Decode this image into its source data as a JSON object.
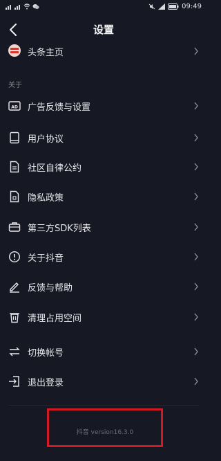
{
  "status_bar": {
    "time": "09:49",
    "icons_left": [
      "sim1-signal-icon",
      "sim2-signal-icon",
      "wifi-icon",
      "wechat-icon"
    ],
    "icons_right": [
      "mute-icon",
      "signal-icon",
      "battery-icon"
    ]
  },
  "header": {
    "title": "设置",
    "back_icon": "chevron-left-icon"
  },
  "profile_row": {
    "label": "头条主页"
  },
  "section": {
    "about_label": "关于"
  },
  "menu": [
    {
      "label": "广告反馈与设置",
      "icon": "ad-icon"
    },
    {
      "label": "用户协议",
      "icon": "book-icon"
    },
    {
      "label": "社区自律公约",
      "icon": "document-icon"
    },
    {
      "label": "隐私政策",
      "icon": "privacy-doc-icon"
    },
    {
      "label": "第三方SDK列表",
      "icon": "briefcase-icon"
    },
    {
      "label": "关于抖音",
      "icon": "info-icon"
    },
    {
      "label": "反馈与帮助",
      "icon": "edit-icon"
    },
    {
      "label": "清理占用空间",
      "icon": "trash-icon"
    },
    {
      "label": "切换帐号",
      "icon": "switch-icon"
    },
    {
      "label": "退出登录",
      "icon": "logout-icon"
    }
  ],
  "footer": {
    "version": "抖音 version16.3.0"
  },
  "colors": {
    "background": "#161823",
    "highlight_border": "#d31a24"
  }
}
